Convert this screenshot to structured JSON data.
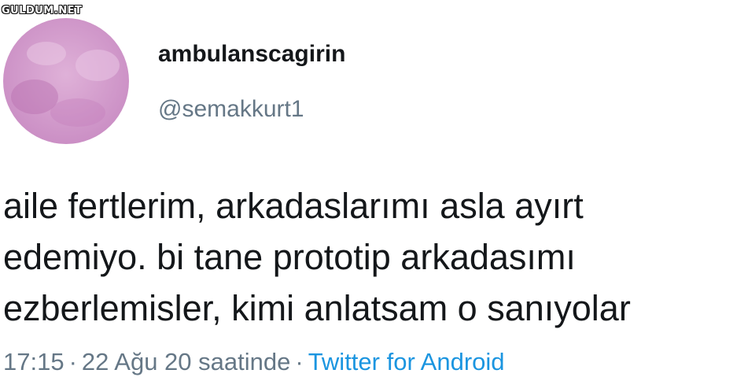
{
  "watermark": "GULDUM.NET",
  "user": {
    "display_name": "ambulanscagirin",
    "handle": "@semakkurt1"
  },
  "tweet": {
    "lines": [
      "aile fertlerim, arkadaslarımı asla ayırt",
      "edemiyo. bi tane prototip arkadasımı",
      "ezberlemisler, kimi anlatsam o sanıyolar"
    ]
  },
  "meta": {
    "time": "17:15",
    "separator": "·",
    "date_text": "22 Ağu 20 saatinde",
    "source": "Twitter for Android"
  },
  "colors": {
    "name": "#14171a",
    "secondary": "#657786",
    "link": "#1b95e0",
    "avatar": "#d9a3cf"
  }
}
